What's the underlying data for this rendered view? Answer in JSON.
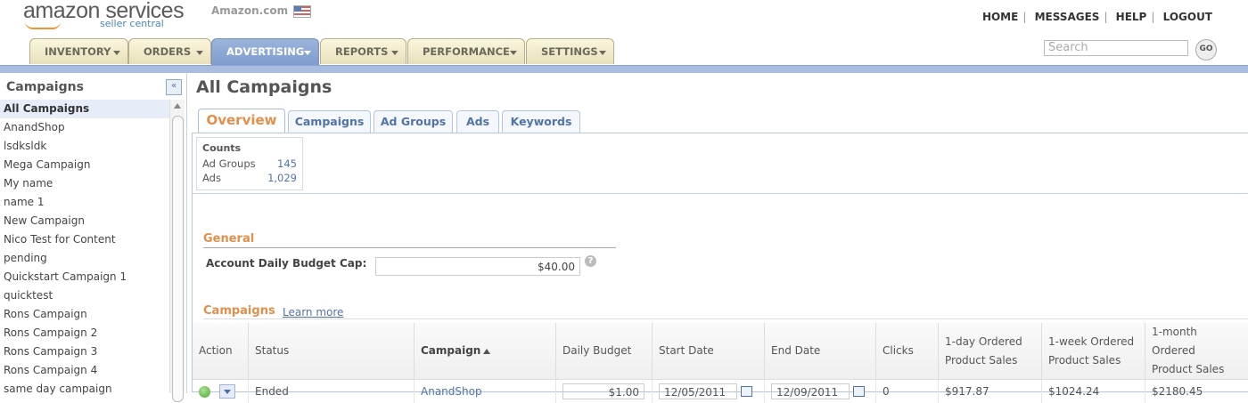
{
  "header": {
    "logo_brand": "amazon services",
    "logo_sub": "seller central",
    "marketplace": "Amazon.com",
    "links": [
      "HOME",
      "MESSAGES",
      "HELP",
      "LOGOUT"
    ],
    "search_placeholder": "Search",
    "go_label": "GO"
  },
  "nav": {
    "tabs": [
      "INVENTORY",
      "ORDERS",
      "ADVERTISING",
      "REPORTS",
      "PERFORMANCE",
      "SETTINGS"
    ],
    "active": "ADVERTISING"
  },
  "sidebar": {
    "title": "Campaigns",
    "collapse_label": "«",
    "items": [
      "All Campaigns",
      "AnandShop",
      "lsdksldk",
      "Mega Campaign",
      "My name",
      "name 1",
      "New Campaign",
      "Nico Test for Content",
      "pending",
      "Quickstart Campaign 1",
      "quicktest",
      "Rons Campaign",
      "Rons Campaign 2",
      "Rons Campaign 3",
      "Rons Campaign 4",
      "same day campaign"
    ]
  },
  "main": {
    "title": "All Campaigns",
    "subtabs": [
      "Overview",
      "Campaigns",
      "Ad Groups",
      "Ads",
      "Keywords"
    ],
    "counts": {
      "title": "Counts",
      "ad_groups_label": "Ad Groups",
      "ad_groups_value": "145",
      "ads_label": "Ads",
      "ads_value": "1,029"
    },
    "general": {
      "title": "General",
      "budget_cap_label": "Account Daily Budget Cap:",
      "budget_cap_value": "$40.00",
      "help": "?"
    },
    "campaigns": {
      "title": "Campaigns",
      "learn_more": "Learn more",
      "headers": {
        "action": "Action",
        "status": "Status",
        "campaign": "Campaign",
        "daily_budget": "Daily Budget",
        "start_date": "Start Date",
        "end_date": "End Date",
        "clicks": "Clicks",
        "sales_1d_a": "1-day Ordered",
        "sales_1d_b": "Product Sales",
        "sales_1w_a": "1-week Ordered",
        "sales_1w_b": "Product Sales",
        "sales_1m_a": "1-month Ordered",
        "sales_1m_b": "Product Sales"
      },
      "rows": [
        {
          "status": "Ended",
          "campaign": "AnandShop",
          "daily_budget": "$1.00",
          "start_date": "12/05/2011",
          "end_date": "12/09/2011",
          "clicks": "0",
          "sales_1d": "$917.87",
          "sales_1w": "$1024.24",
          "sales_1m": "$2180.45"
        }
      ]
    }
  }
}
